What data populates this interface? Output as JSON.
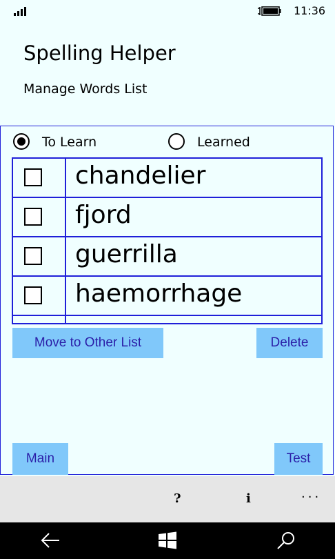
{
  "status": {
    "time": "11:36"
  },
  "header": {
    "app_title": "Spelling Helper",
    "page_subtitle": "Manage Words List"
  },
  "list_filter": {
    "options": [
      {
        "label": "To Learn",
        "selected": true
      },
      {
        "label": "Learned",
        "selected": false
      }
    ]
  },
  "words": [
    {
      "text": "chandelier",
      "checked": false
    },
    {
      "text": "fjord",
      "checked": false
    },
    {
      "text": "guerrilla",
      "checked": false
    },
    {
      "text": "haemorrhage",
      "checked": false
    }
  ],
  "actions": {
    "move_label": "Move to Other List",
    "delete_label": "Delete",
    "main_label": "Main",
    "test_label": "Test"
  },
  "app_bar": {
    "help_label": "?",
    "info_label": "i",
    "more_label": "···"
  },
  "colors": {
    "background": "#f0ffff",
    "border": "#1f1fd9",
    "button": "#80c8fa",
    "button_text": "#2b1fa8"
  }
}
